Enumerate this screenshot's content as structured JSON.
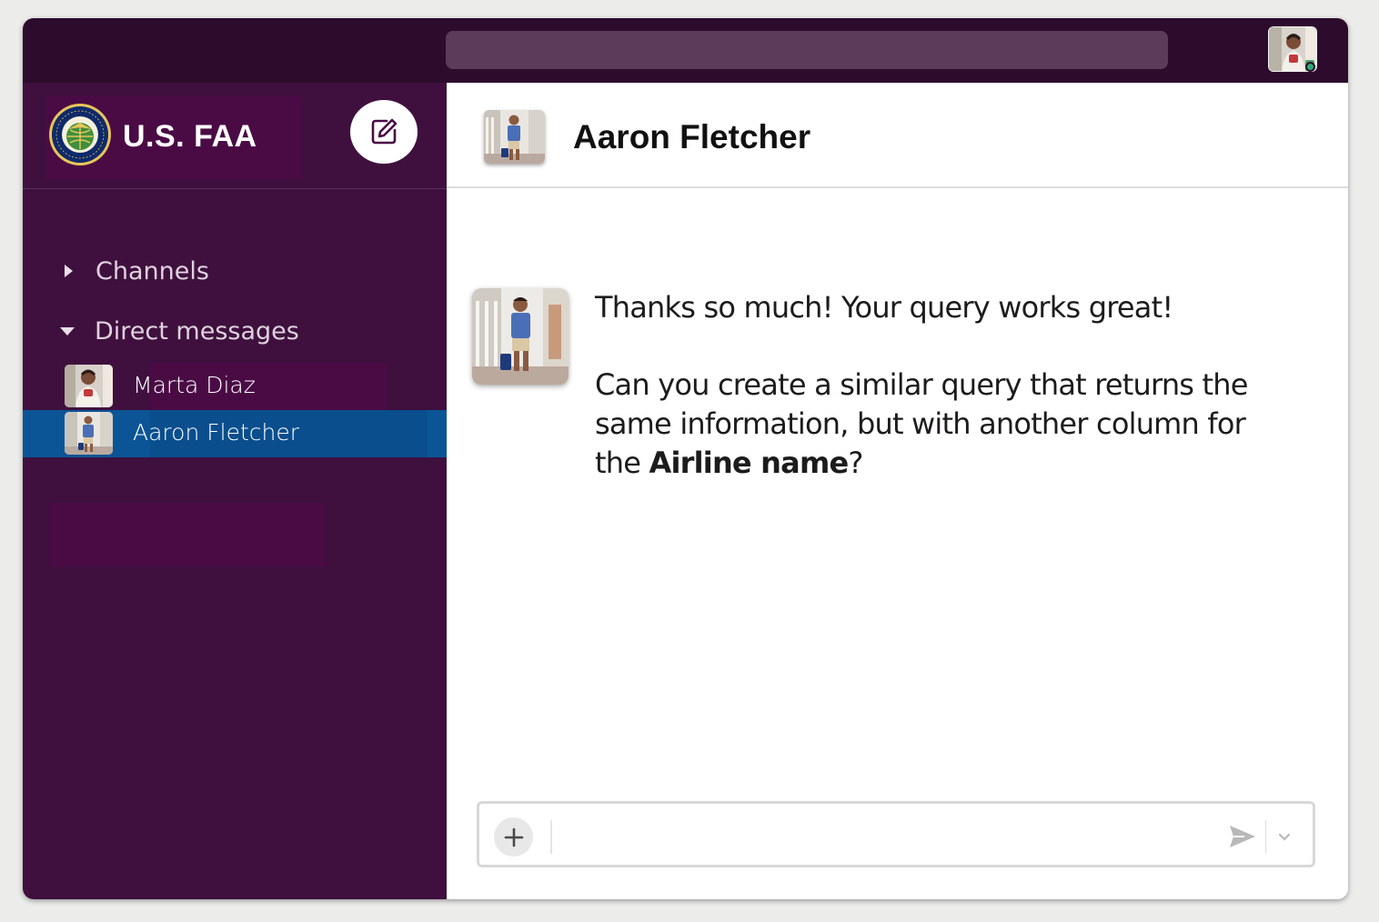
{
  "workspace": {
    "name": "U.S. FAA",
    "logo_icon": "faa-seal-icon"
  },
  "topbar": {
    "search_placeholder": "",
    "user_avatar": "user-avatar-marta",
    "presence": "online"
  },
  "sidebar": {
    "sections": [
      {
        "label": "Channels",
        "expanded": false
      },
      {
        "label": "Direct messages",
        "expanded": true
      }
    ],
    "direct_messages": [
      {
        "name": "Marta Diaz",
        "selected": false
      },
      {
        "name": "Aaron Fletcher",
        "selected": true
      }
    ]
  },
  "conversation": {
    "title": "Aaron Fletcher",
    "messages": [
      {
        "author": "Aaron Fletcher",
        "line1": "Thanks so much! Your query works great!",
        "line2_pre": "Can you create a similar query that returns the same information, but with another column for the ",
        "line2_bold": "Airline name",
        "line2_post": "?"
      }
    ]
  },
  "composer": {
    "placeholder": "",
    "attach_icon": "plus-icon",
    "send_icon": "send-icon",
    "options_icon": "chevron-down-icon"
  },
  "colors": {
    "topbar": "#2d0b2c",
    "sidebar": "#3f103e",
    "selected": "#0b5596",
    "accent": "#4a0b45"
  }
}
